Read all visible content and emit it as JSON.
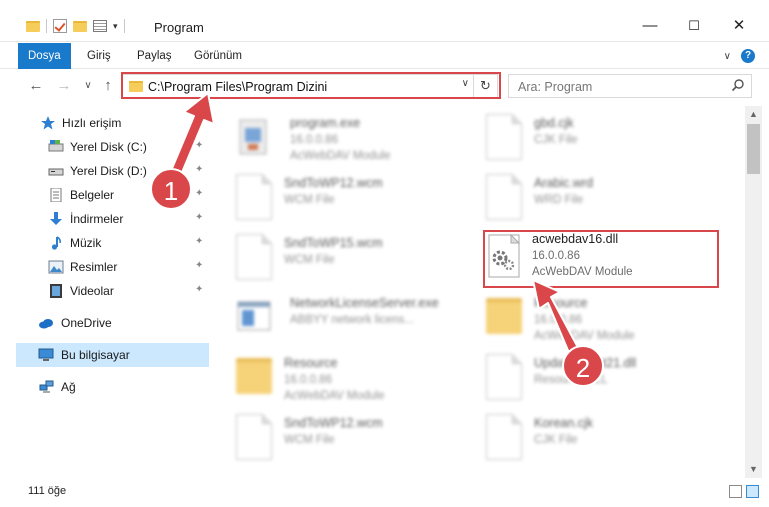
{
  "window": {
    "title": "Program",
    "minimize": "—",
    "maximize": "☐",
    "close": "✕"
  },
  "ribbon": {
    "tabs": [
      "Dosya",
      "Giriş",
      "Paylaş",
      "Görünüm"
    ],
    "active_tab": "Dosya",
    "expand_label": "∨",
    "help_label": "?"
  },
  "nav": {
    "back": "←",
    "forward": "→",
    "recent": "∨",
    "up": "↑",
    "address": "C:\\Program Files\\Program Dizini",
    "address_dropdown": "∨",
    "refresh": "↻",
    "search_placeholder": "Ara: Program"
  },
  "sidebar": {
    "items": [
      {
        "label": "Hızlı erişim",
        "icon": "star-icon",
        "pinned": false
      },
      {
        "label": "Yerel Disk (C:)",
        "icon": "drive-icon",
        "pinned": true
      },
      {
        "label": "Yerel Disk (D:)",
        "icon": "drive-icon",
        "pinned": true
      },
      {
        "label": "Belgeler",
        "icon": "documents-icon",
        "pinned": true
      },
      {
        "label": "İndirmeler",
        "icon": "download-icon",
        "pinned": true
      },
      {
        "label": "Müzik",
        "icon": "music-icon",
        "pinned": true
      },
      {
        "label": "Resimler",
        "icon": "pictures-icon",
        "pinned": true
      },
      {
        "label": "Videolar",
        "icon": "videos-icon",
        "pinned": true
      },
      {
        "label": "OneDrive",
        "icon": "cloud-icon",
        "pinned": false
      },
      {
        "label": "Bu bilgisayar",
        "icon": "computer-icon",
        "pinned": false,
        "selected": true
      },
      {
        "label": "Ağ",
        "icon": "network-icon",
        "pinned": false
      }
    ],
    "pin_glyph": "📌"
  },
  "files": [
    {
      "name": "program.exe",
      "version": "16.0.0.86",
      "desc": "AcWebDAV Module",
      "icon": "exe-icon",
      "blurred": true
    },
    {
      "name": "gbd.cjk",
      "version": "CJK File",
      "desc": "",
      "icon": "document-icon",
      "blurred": true
    },
    {
      "name": "SndToWP12.wcm",
      "version": "WCM File",
      "desc": "",
      "icon": "document-icon",
      "blurred": true
    },
    {
      "name": "Arabic.wrd",
      "version": "WRD File",
      "desc": "",
      "icon": "document-icon",
      "blurred": true
    },
    {
      "name": "SndToWP15.wcm",
      "version": "WCM File",
      "desc": "",
      "icon": "document-icon",
      "blurred": true
    },
    {
      "name": "acwebdav16.dll",
      "version": "16.0.0.86",
      "desc": "AcWebDAV Module",
      "icon": "dll-gear-icon",
      "blurred": false
    },
    {
      "name": "NetworkLicenseServer.exe",
      "version": "ABBYY network licens...",
      "desc": "",
      "icon": "exe-window-icon",
      "blurred": true
    },
    {
      "name": "Resource",
      "version": "16.0.0.86",
      "desc": "AcWebDAV Module",
      "icon": "folder-icon",
      "blurred": true
    },
    {
      "name": "Resource",
      "version": "16.0.0.86",
      "desc": "AcWebDAV Module",
      "icon": "folder-icon",
      "blurred": true
    },
    {
      "name": "UpdateClient21.dll",
      "version": "Resource DLL",
      "desc": "",
      "icon": "dll-icon",
      "blurred": true
    },
    {
      "name": "SndToWP12.wcm",
      "version": "WCM File",
      "desc": "",
      "icon": "document-icon",
      "blurred": true
    },
    {
      "name": "Korean.cjk",
      "version": "CJK File",
      "desc": "",
      "icon": "document-icon",
      "blurred": true
    }
  ],
  "status": {
    "count": "111 öğe"
  },
  "annotations": {
    "step1": "1",
    "step2": "2",
    "color": "#d9474a"
  }
}
